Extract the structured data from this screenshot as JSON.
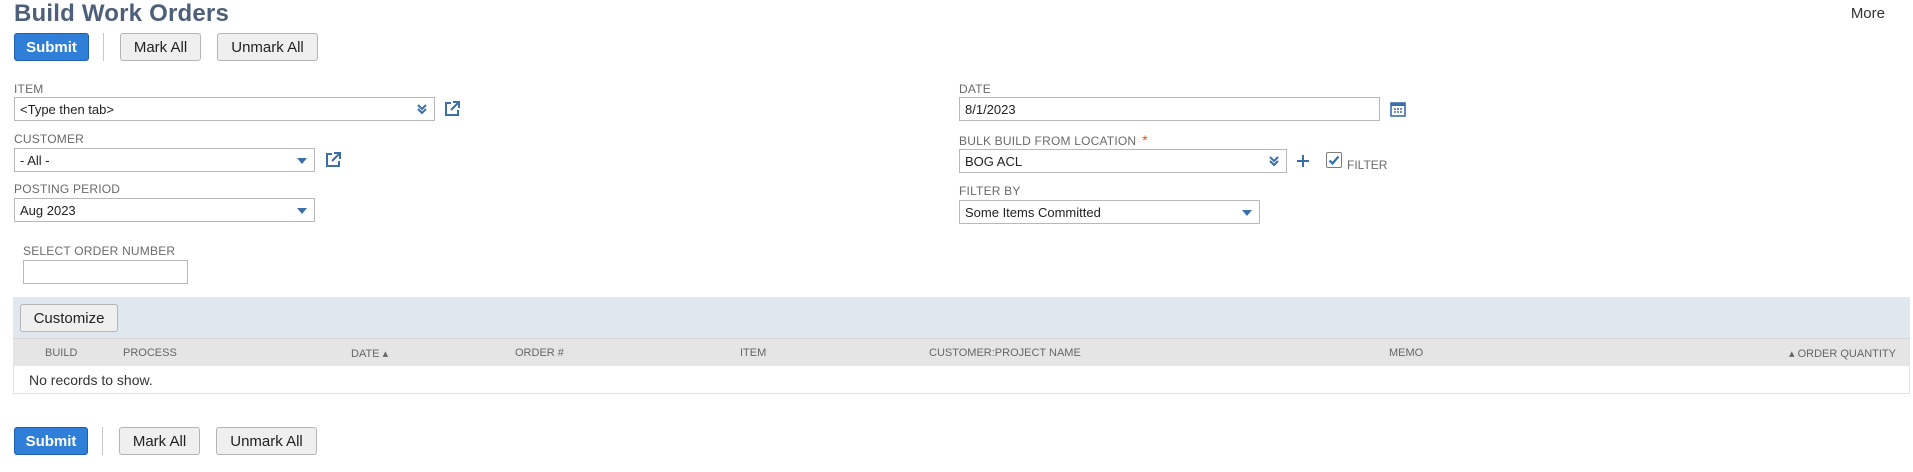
{
  "page": {
    "title": "Build Work Orders",
    "more": "More"
  },
  "toolbar_top": {
    "submit": "Submit",
    "mark_all": "Mark All",
    "unmark_all": "Unmark All"
  },
  "toolbar_bottom": {
    "submit": "Submit",
    "mark_all": "Mark All",
    "unmark_all": "Unmark All"
  },
  "fields": {
    "item": {
      "label": "ITEM",
      "value": "<Type then tab>"
    },
    "customer": {
      "label": "CUSTOMER",
      "value": "- All -"
    },
    "posting_period": {
      "label": "POSTING PERIOD",
      "value": "Aug 2023"
    },
    "select_order_number": {
      "label": "SELECT ORDER NUMBER",
      "value": ""
    },
    "date": {
      "label": "DATE",
      "value": "8/1/2023"
    },
    "bulk_build_location": {
      "label": "BULK BUILD FROM LOCATION",
      "required": "*",
      "value": "BOG ACL"
    },
    "filter": {
      "label": "FILTER",
      "checked": true
    },
    "filter_by": {
      "label": "FILTER BY",
      "value": "Some Items Committed"
    }
  },
  "grid": {
    "customize": "Customize",
    "columns": [
      "BUILD",
      "PROCESS",
      "DATE ▴",
      "ORDER #",
      "ITEM",
      "CUSTOMER:PROJECT NAME",
      "MEMO",
      "▴ ORDER QUANTITY"
    ],
    "empty_text": "No records to show."
  },
  "colors": {
    "primary": "#2f7fd9",
    "title": "#4d5f79",
    "grid_band": "#e1e7ef",
    "icon": "#3a6fa8"
  },
  "icons": [
    "double-chevron-down-icon",
    "open-link-icon",
    "chevron-down-icon",
    "calendar-icon",
    "plus-icon",
    "checkmark-icon"
  ]
}
